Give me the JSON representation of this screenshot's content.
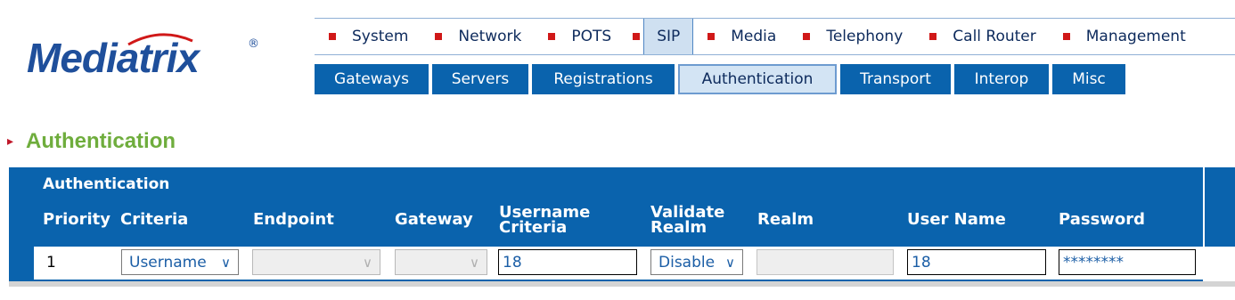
{
  "logo": {
    "text": "Mediatrix",
    "reg": "®"
  },
  "top_menu": [
    {
      "label": "System"
    },
    {
      "label": "Network"
    },
    {
      "label": "POTS"
    },
    {
      "label": "SIP"
    },
    {
      "label": "Media"
    },
    {
      "label": "Telephony"
    },
    {
      "label": "Call Router"
    },
    {
      "label": "Management"
    }
  ],
  "top_menu_active": "SIP",
  "sub_tabs": [
    {
      "label": "Gateways"
    },
    {
      "label": "Servers"
    },
    {
      "label": "Registrations"
    },
    {
      "label": "Authentication"
    },
    {
      "label": "Transport"
    },
    {
      "label": "Interop"
    },
    {
      "label": "Misc"
    }
  ],
  "sub_tab_active": "Authentication",
  "section": {
    "title": "Authentication",
    "arrow": "▸"
  },
  "table": {
    "group_title": "Authentication",
    "headers": {
      "priority": "Priority",
      "criteria": "Criteria",
      "endpoint": "Endpoint",
      "gateway": "Gateway",
      "username_criteria_1": "Username",
      "username_criteria_2": "Criteria",
      "validate_realm_1": "Validate",
      "validate_realm_2": "Realm",
      "realm": "Realm",
      "user_name": "User Name",
      "password": "Password"
    },
    "row": {
      "priority": "1",
      "criteria": "Username",
      "endpoint": "",
      "gateway": "",
      "username_criteria": "18",
      "validate_realm": "Disable",
      "realm": "",
      "user_name": "18",
      "password": "********"
    }
  },
  "colors": {
    "brand_blue": "#0a63ad",
    "logo_blue": "#1f4f9b",
    "heading_green": "#6fad3d",
    "menu_bullet_red": "#d01818",
    "field_text_blue": "#1b5ea6"
  }
}
